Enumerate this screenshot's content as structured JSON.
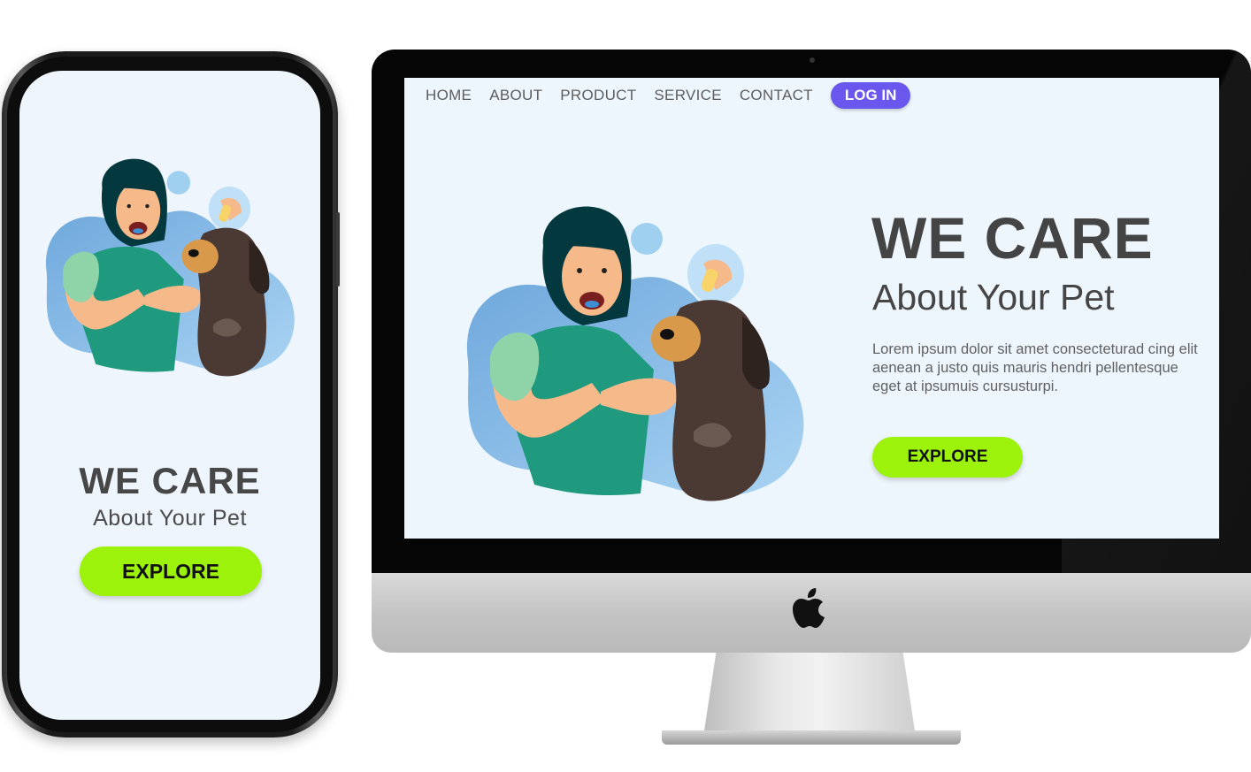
{
  "phone": {
    "title": "WE CARE",
    "subtitle": "About Your Pet",
    "explore_label": "EXPLORE"
  },
  "desktop": {
    "nav": [
      "HOME",
      "ABOUT",
      "PRODUCT",
      "SERVICE",
      "CONTACT"
    ],
    "login_label": "LOG IN",
    "title": "WE CARE",
    "subtitle": "About Your Pet",
    "body": "Lorem ipsum dolor sit amet consecteturad cing elit aenean a justo quis mauris hendri pellentesque eget at ipsumuis cursusturpi.",
    "explore_label": "EXPLORE"
  },
  "icons": {
    "brand": "apple-logo-icon"
  },
  "colors": {
    "accent_green": "#9df20b",
    "login_purple": "#6a58ee",
    "screen_bg": "#eef6fd",
    "heading": "#444444"
  }
}
